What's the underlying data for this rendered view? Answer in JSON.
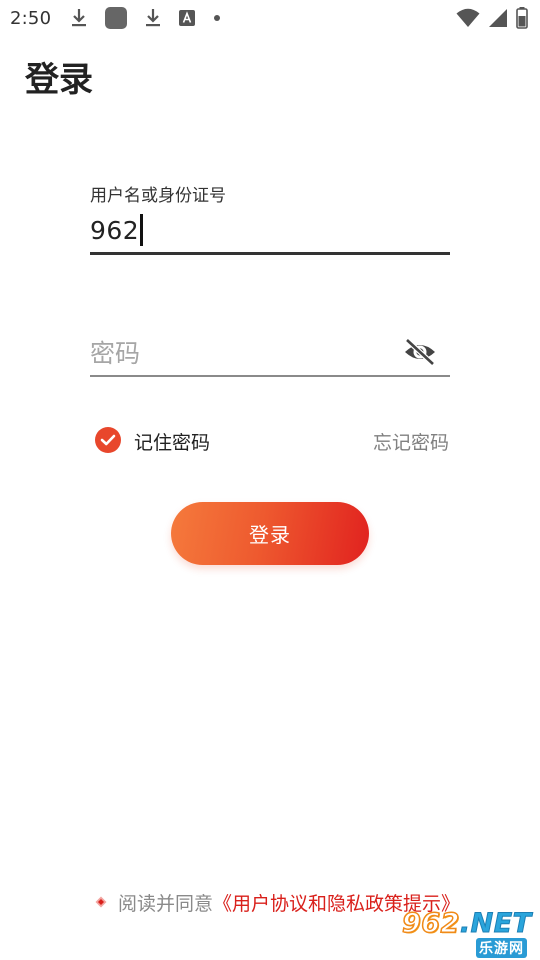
{
  "status_bar": {
    "time": "2:50",
    "left_icons": [
      "download-icon",
      "app-icon",
      "download-icon",
      "font-app-icon",
      "dot-icon"
    ],
    "right_icons": [
      "wifi-icon",
      "cell-signal-icon",
      "battery-icon"
    ]
  },
  "page": {
    "title": "登录"
  },
  "username": {
    "label": "用户名或身份证号",
    "value": "962"
  },
  "password": {
    "placeholder": "密码",
    "toggle_icon": "eye-off-icon"
  },
  "remember": {
    "checked": true,
    "label": "记住密码"
  },
  "forgot": {
    "label": "忘记密码"
  },
  "login_button": {
    "label": "登录"
  },
  "agreement": {
    "prefix": "阅读并同意",
    "link": "《用户协议和隐私政策提示》"
  },
  "watermark": {
    "number": "962",
    "domain": ".NET",
    "subtitle": "乐游网"
  },
  "colors": {
    "accent": "#e8472c",
    "link_red": "#d9201b",
    "button_gradient_start": "#f57a3c",
    "button_gradient_end": "#e1221f"
  }
}
